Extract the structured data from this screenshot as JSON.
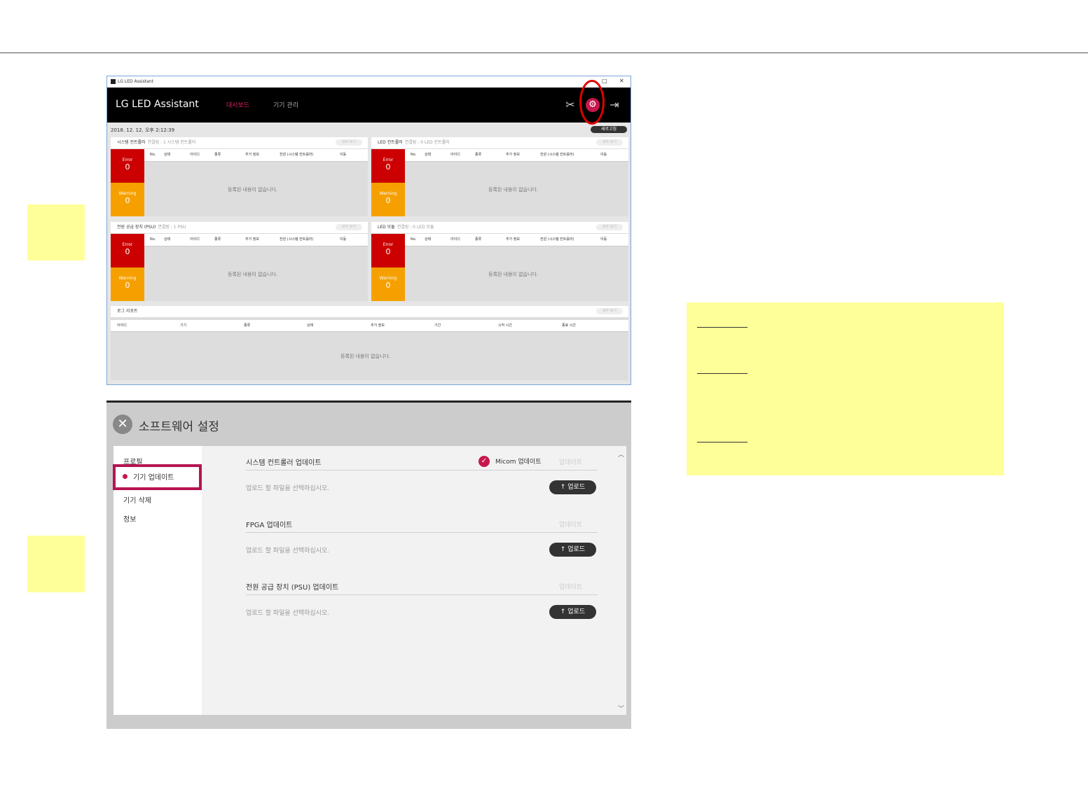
{
  "window": {
    "titlebar_text": "LG LED Assistant",
    "brand": "LG LED Assistant",
    "nav": [
      "대시보드",
      "기기 관리"
    ],
    "timestamp": "2018. 12. 12. 오후 2:12:39",
    "refresh_label": "새로고침"
  },
  "panels": {
    "system": {
      "title": "시스템 컨트롤러",
      "sub": "연결됨 : 1 시스템 컨트롤러",
      "view_all": "모두 보기"
    },
    "led": {
      "title": "LED 컨트롤러",
      "sub": "연결됨 : 0 LED 컨트롤러",
      "view_all": "모두 보기"
    },
    "psu": {
      "title": "전원 공급 장치 (PSU)",
      "sub": "연결됨 : 1 PSU",
      "view_all": "모두 보기"
    },
    "module": {
      "title": "LED 모듈",
      "sub": "연결됨 : 0 LED 모듈",
      "view_all": "모두 보기"
    },
    "log": {
      "title": "로그 리포트",
      "view_all": "모두 보기"
    }
  },
  "status": {
    "error_label": "Error",
    "error_count": "0",
    "warning_label": "Warning",
    "warning_count": "0"
  },
  "columns": [
    "No.",
    "상태",
    "아이디",
    "종류",
    "추가 정보",
    "전원 (시스템 컨트롤러)",
    "이동"
  ],
  "log_columns": [
    "아이디",
    "기기",
    "종류",
    "상태",
    "추가 정보",
    "기간",
    "시작 시간",
    "종료 시간"
  ],
  "empty_text": "등록된 내용이 없습니다.",
  "settings": {
    "title": "소프트웨어 설정",
    "sidebar": [
      "프로필",
      "기기 업데이트",
      "기기 삭제",
      "정보"
    ],
    "sections": [
      {
        "title": "시스템 컨트롤러 업데이트",
        "update": "업데이트",
        "hint": "업로드 할 파일을 선택하십시오.",
        "upload": "업로드"
      },
      {
        "title": "FPGA 업데이트",
        "update": "업데이트",
        "hint": "업로드 할 파일을 선택하십시오.",
        "upload": "업로드"
      },
      {
        "title": "전원 공급 장치 (PSU) 업데이트",
        "update": "업데이트",
        "hint": "업로드 할 파일을 선택하십시오.",
        "upload": "업로드"
      }
    ],
    "micom_label": "Micom 업데이트"
  },
  "colors": {
    "accent": "#c8174d",
    "error": "#cc0000",
    "warning": "#f5a000",
    "note": "#ffff99"
  }
}
